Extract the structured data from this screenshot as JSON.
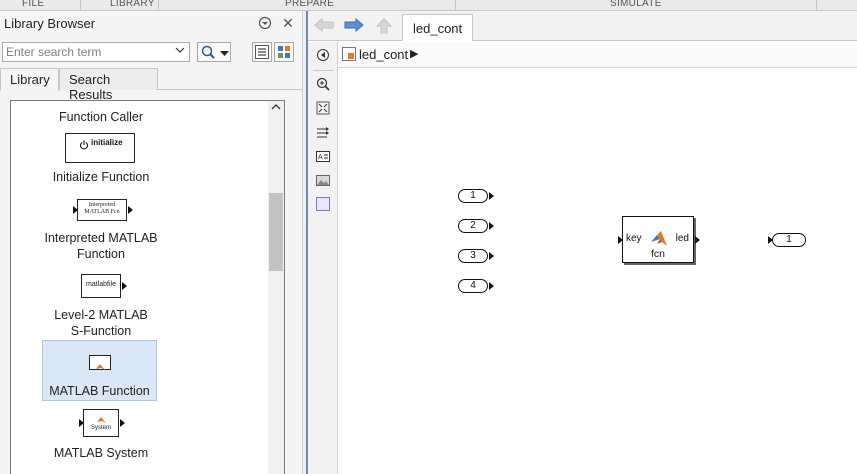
{
  "ribbon": {
    "tabs": [
      "FILE",
      "LIBRARY",
      "PREPARE",
      "SIMULATE"
    ]
  },
  "library": {
    "title": "Library Browser",
    "search_placeholder": "Enter search term",
    "tabs": [
      {
        "label": "Library",
        "active": true
      },
      {
        "label": "Search Results",
        "active": false
      }
    ],
    "items": [
      {
        "label": "Function Caller",
        "icon_text": ""
      },
      {
        "label": "Initialize Function",
        "icon_text": "initialize"
      },
      {
        "label": "Interpreted MATLAB Function",
        "label_line1": "Interpreted MATLAB",
        "label_line2": "Function",
        "icon_text_line1": "Interpreted",
        "icon_text_line2": "MATLAB Fcn"
      },
      {
        "label": "Level-2 MATLAB S-Function",
        "label_line1": "Level-2 MATLAB",
        "label_line2": "S-Function",
        "icon_text": "matlabfile"
      },
      {
        "label": "MATLAB Function",
        "selected": true
      },
      {
        "label": "MATLAB System",
        "icon_text": "System"
      }
    ]
  },
  "editor": {
    "model_tab": "led_cont",
    "breadcrumb": "led_cont",
    "inports": [
      "1",
      "2",
      "3",
      "4"
    ],
    "outports": [
      "1"
    ],
    "fcn_block": {
      "input_label": "key",
      "output_label": "led",
      "name": "fcn"
    }
  },
  "colors": {
    "selection": "#d9e7f6",
    "editor_border": "#6b8bb7",
    "matlab_logo": "#e07b2a"
  }
}
